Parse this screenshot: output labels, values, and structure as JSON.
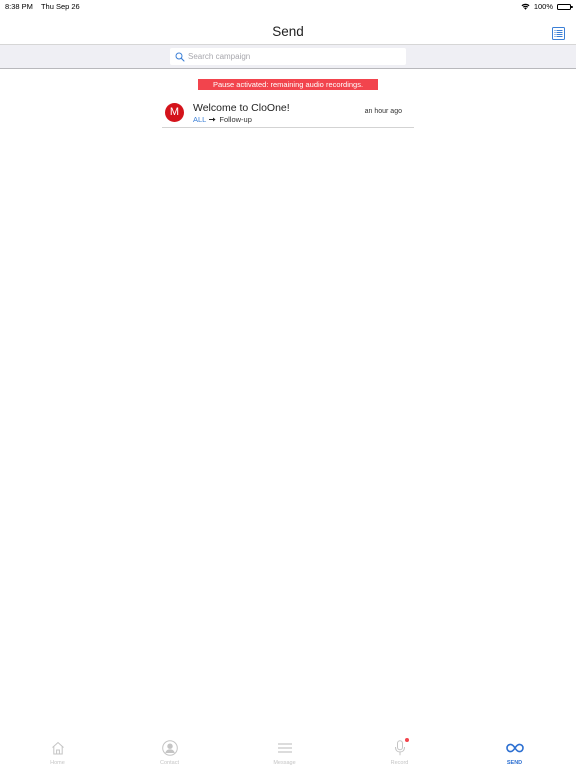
{
  "status_bar": {
    "time": "8:38 PM",
    "date": "Thu Sep 26",
    "battery": "100%"
  },
  "nav": {
    "title": "Send"
  },
  "search": {
    "placeholder": "Search campaign",
    "value": ""
  },
  "banner": {
    "text": "Pause activated: remaining audio recordings."
  },
  "campaigns": [
    {
      "avatar_letter": "M",
      "title": "Welcome to CloOne!",
      "audience": "ALL",
      "step": "Follow-up",
      "time": "an hour ago"
    }
  ],
  "tabs": [
    {
      "label": "Home",
      "icon": "home-icon",
      "active": false
    },
    {
      "label": "Contact",
      "icon": "contact-icon",
      "active": false
    },
    {
      "label": "Message",
      "icon": "menu-icon",
      "active": false
    },
    {
      "label": "Record",
      "icon": "microphone-icon",
      "active": false
    },
    {
      "label": "SEND",
      "icon": "infinity-icon",
      "active": true
    }
  ],
  "colors": {
    "accent": "#2c6fd1",
    "banner": "#f2444d",
    "avatar": "#d4131b",
    "tag": "#3b7fd6",
    "inactive": "#c4c4c4"
  }
}
